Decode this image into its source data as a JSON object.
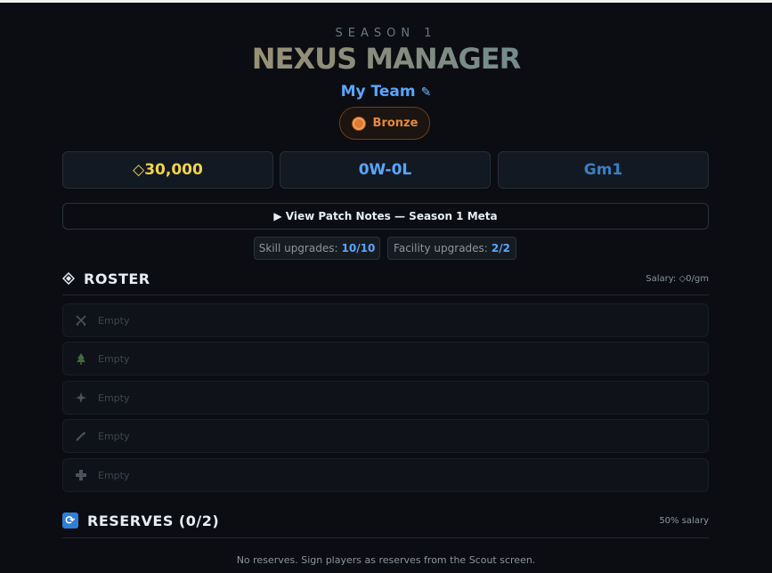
{
  "header": {
    "season": "SEASON 1",
    "title": "NEXUS MANAGER",
    "team_name": "My Team",
    "edit_icon": "pencil-icon",
    "rank": "Bronze",
    "rank_icon": "bronze-medal-icon"
  },
  "stats": {
    "money": "◇30,000",
    "record": "0W-0L",
    "game": "Gm1"
  },
  "patch_notes": {
    "label": "▶ View Patch Notes — Season 1 Meta"
  },
  "upgrades": {
    "skill_label": "Skill upgrades:",
    "skill_value": "10/10",
    "facility_label": "Facility upgrades:",
    "facility_value": "2/2"
  },
  "roster": {
    "title": "ROSTER",
    "icon": "diamond-icon",
    "salary": "Salary: ◇0/gm",
    "slots": [
      {
        "role_icon": "crossed-swords-icon",
        "label": "Empty"
      },
      {
        "role_icon": "tree-icon",
        "label": "Empty"
      },
      {
        "role_icon": "sparkle-icon",
        "label": "Empty"
      },
      {
        "role_icon": "wand-icon",
        "label": "Empty"
      },
      {
        "role_icon": "plus-icon",
        "label": "Empty"
      }
    ]
  },
  "reserves": {
    "title": "RESERVES (0/2)",
    "icon": "refresh-icon",
    "salary_note": "50% salary",
    "empty_message": "No reserves. Sign players as reserves from the Scout screen."
  },
  "colors": {
    "background": "#0b0d12",
    "accent_blue": "#58a6ff",
    "gold": "#f0d34a",
    "bronze": "#e8883a"
  }
}
